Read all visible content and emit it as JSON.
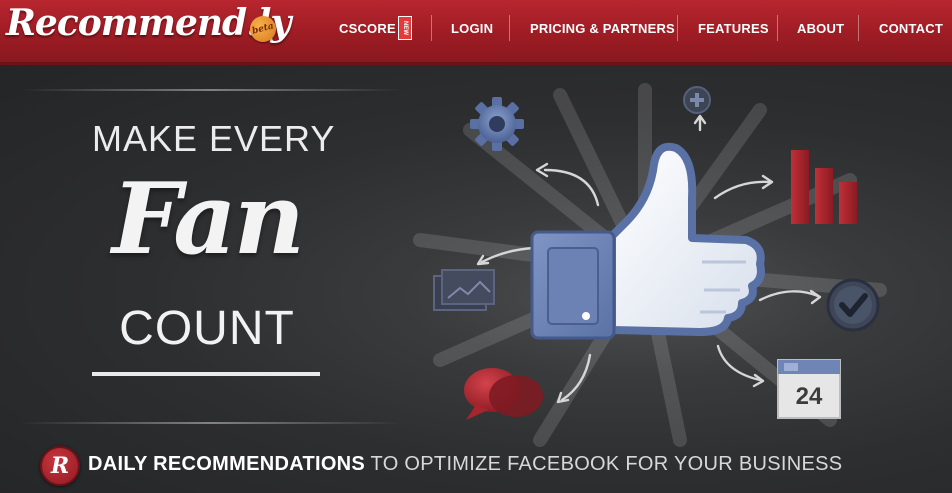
{
  "brand": {
    "name": "Recommend.ly",
    "badge": "beta"
  },
  "nav": {
    "items": [
      {
        "label": "CSCORE",
        "badge": "NEW"
      },
      {
        "label": "LOGIN"
      },
      {
        "label": "PRICING & PARTNERS"
      },
      {
        "label": "FEATURES"
      },
      {
        "label": "ABOUT"
      },
      {
        "label": "CONTACT"
      }
    ]
  },
  "hero": {
    "headline_top": "MAKE EVERY",
    "headline_script": "Fan",
    "headline_bottom": "COUNT",
    "calendar_day": "24",
    "badge_letter": "R",
    "tagline_bold": "DAILY RECOMMENDATIONS",
    "tagline_rest": " TO OPTIMIZE FACEBOOK FOR YOUR BUSINESS"
  },
  "colors": {
    "nav_red": "#a4212a",
    "background": "#2d2e30",
    "facebook_blue": "#6f85b6",
    "accent_red": "#b52a33"
  },
  "icons": [
    "gear-icon",
    "plus-circle-icon",
    "bar-chart-icon",
    "thumbs-up-icon",
    "checkmark-icon",
    "calendar-icon",
    "chat-bubbles-icon",
    "photos-icon"
  ]
}
